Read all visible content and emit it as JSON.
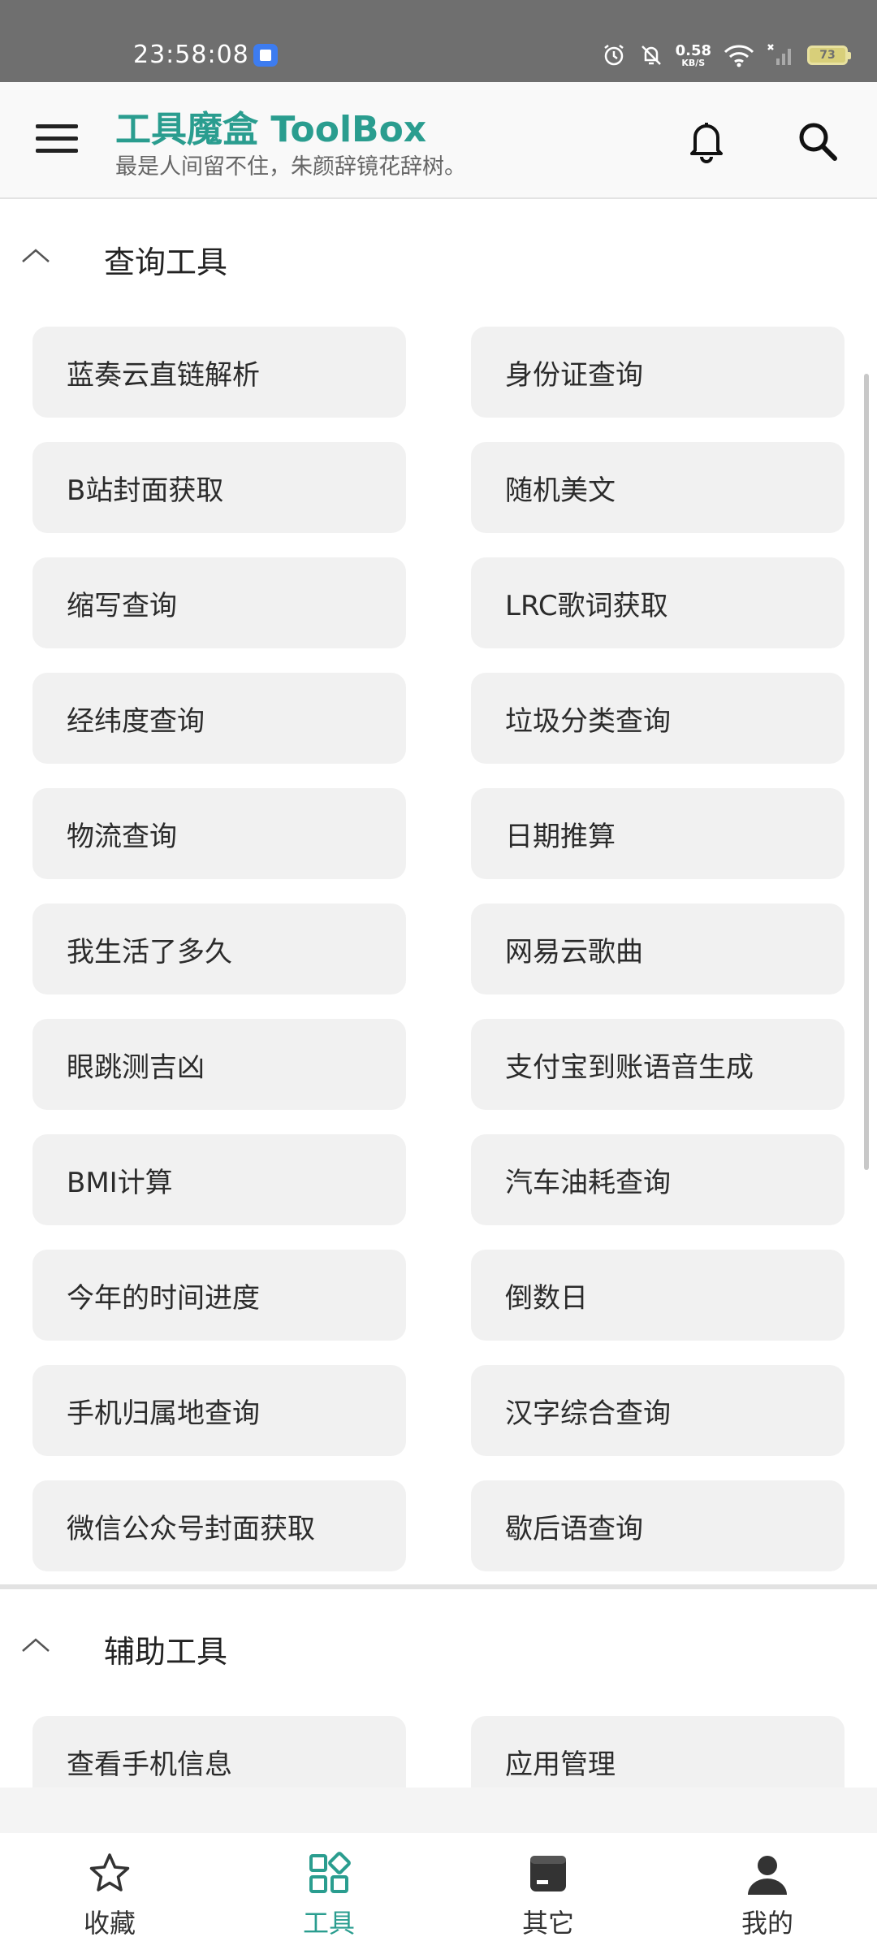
{
  "status_bar": {
    "time": "23:58:08",
    "net_speed": "0.58",
    "net_unit": "KB/S",
    "battery": "73"
  },
  "app_bar": {
    "title": "工具魔盒 ToolBox",
    "subtitle": "最是人间留不住，朱颜辞镜花辞树。"
  },
  "sections": [
    {
      "title": "查询工具",
      "tools": [
        "蓝奏云直链解析",
        "身份证查询",
        "B站封面获取",
        "随机美文",
        "缩写查询",
        "LRC歌词获取",
        "经纬度查询",
        "垃圾分类查询",
        "物流查询",
        "日期推算",
        "我生活了多久",
        "网易云歌曲",
        "眼跳测吉凶",
        "支付宝到账语音生成",
        "BMI计算",
        "汽车油耗查询",
        "今年的时间进度",
        "倒数日",
        "手机归属地查询",
        "汉字综合查询",
        "微信公众号封面获取",
        "歇后语查询"
      ]
    },
    {
      "title": "辅助工具",
      "tools": [
        "查看手机信息",
        "应用管理"
      ]
    }
  ],
  "bottom_nav": [
    {
      "label": "收藏",
      "icon": "star-icon",
      "active": false
    },
    {
      "label": "工具",
      "icon": "grid-icon",
      "active": true
    },
    {
      "label": "其它",
      "icon": "folder-icon",
      "active": false
    },
    {
      "label": "我的",
      "icon": "person-icon",
      "active": false
    }
  ],
  "colors": {
    "accent": "#2a9d8f",
    "button_bg": "#f1f1f1",
    "status_bar_bg": "#6f6f6f"
  }
}
